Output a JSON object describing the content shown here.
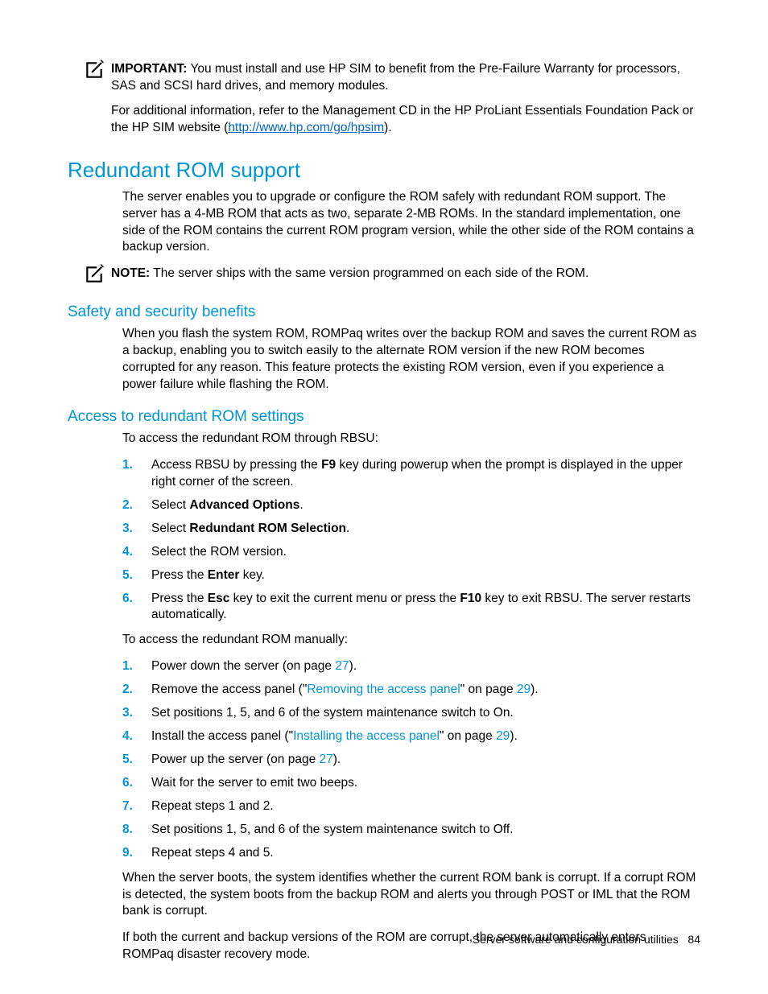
{
  "callout_important": {
    "label": "IMPORTANT:",
    "text1": "  You must install and use HP SIM to benefit from the Pre-Failure Warranty for processors, SAS and SCSI hard drives, and memory modules.",
    "p2_a": "For additional information, refer to the Management CD in the HP ProLiant Essentials Foundation Pack or the HP SIM website (",
    "p2_link": "http://www.hp.com/go/hpsim",
    "p2_b": ")."
  },
  "h_redundant": "Redundant ROM support",
  "p_redundant": "The server enables you to upgrade or configure the ROM safely with redundant ROM support. The server has a 4-MB ROM that acts as two, separate 2-MB ROMs. In the standard implementation, one side of the ROM contains the current ROM program version, while the other side of the ROM contains a backup version.",
  "callout_note": {
    "label": "NOTE:",
    "text": "  The server ships with the same version programmed on each side of the ROM."
  },
  "h_safety": "Safety and security benefits",
  "p_safety": "When you flash the system ROM, ROMPaq writes over the backup ROM and saves the current ROM as a backup, enabling you to switch easily to the alternate ROM version if the new ROM becomes corrupted for any reason. This feature protects the existing ROM version, even if you experience a power failure while flashing the ROM.",
  "h_access": "Access to redundant ROM settings",
  "p_access_intro": "To access the redundant ROM through RBSU:",
  "list1": [
    {
      "n": "1.",
      "a": "Access RBSU by pressing the ",
      "b": "F9",
      "c": " key during powerup when the prompt is displayed in the upper right corner of the screen."
    },
    {
      "n": "2.",
      "a": "Select ",
      "b": "Advanced Options",
      "c": "."
    },
    {
      "n": "3.",
      "a": "Select ",
      "b": "Redundant ROM Selection",
      "c": "."
    },
    {
      "n": "4.",
      "a": "Select the ROM version."
    },
    {
      "n": "5.",
      "a": "Press the ",
      "b": "Enter",
      "c": " key."
    },
    {
      "n": "6.",
      "a": "Press the ",
      "b": "Esc",
      "c": " key to exit the current menu or press the ",
      "d": "F10",
      "e": " key to exit RBSU. The server restarts automatically."
    }
  ],
  "p_manual_intro": "To access the redundant ROM manually:",
  "list2": [
    {
      "n": "1.",
      "a": "Power down the server (on page ",
      "x": "27",
      "b": ")."
    },
    {
      "n": "2.",
      "a": "Remove the access panel (\"",
      "x": "Removing the access panel",
      "b": "\" on page ",
      "y": "29",
      "c": ")."
    },
    {
      "n": "3.",
      "a": "Set positions 1, 5, and 6 of the system maintenance switch to On."
    },
    {
      "n": "4.",
      "a": "Install the access panel (\"",
      "x": "Installing the access panel",
      "b": "\" on page ",
      "y": "29",
      "c": ")."
    },
    {
      "n": "5.",
      "a": "Power up the server (on page ",
      "x": "27",
      "b": ")."
    },
    {
      "n": "6.",
      "a": "Wait for the server to emit two beeps."
    },
    {
      "n": "7.",
      "a": "Repeat steps 1 and 2."
    },
    {
      "n": "8.",
      "a": "Set positions 1, 5, and 6 of the system maintenance switch to Off."
    },
    {
      "n": "9.",
      "a": "Repeat steps 4 and 5."
    }
  ],
  "p_boot1": "When the server boots, the system identifies whether the current ROM bank is corrupt. If a corrupt ROM is detected, the system boots from the backup ROM and alerts you through POST or IML that the ROM bank is corrupt.",
  "p_boot2": "If both the current and backup versions of the ROM are corrupt, the server automatically enters ROMPaq disaster recovery mode.",
  "footer_a": "Server software and configuration utilities",
  "footer_b": "84"
}
